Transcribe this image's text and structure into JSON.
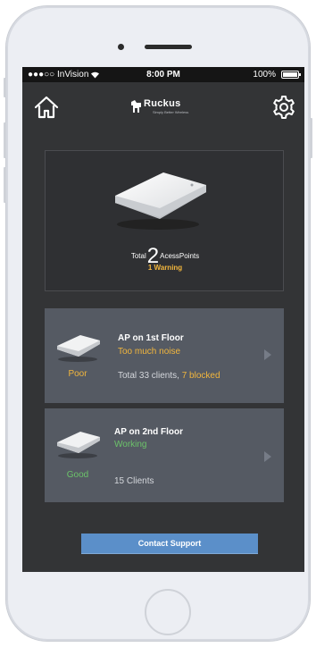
{
  "status_bar": {
    "carrier": "●●●○○ InVision",
    "wifi_icon": "wifi-icon",
    "time": "8:00 PM",
    "battery": "100%"
  },
  "header": {
    "brand": "Ruckus",
    "brand_tagline": "Simply Better Wireless",
    "home_icon": "home-icon",
    "settings_icon": "gear-icon"
  },
  "summary": {
    "total_prefix": "Total",
    "total_count": "2",
    "total_suffix": "AcessPoints",
    "warning": "1 Warning"
  },
  "access_points": [
    {
      "title": "AP on 1st Floor",
      "status_text": "Too much noise",
      "health": "Poor",
      "details_prefix": "Total 33 clients, ",
      "details_highlight": "7 blocked"
    },
    {
      "title": "AP on 2nd Floor",
      "status_text": "Working",
      "health": "Good",
      "details_prefix": "15 Clients",
      "details_highlight": ""
    }
  ],
  "footer": {
    "contact_label": "Contact Support"
  },
  "colors": {
    "screen_bg": "#333436",
    "card_bg": "#555a63",
    "warning": "#f2b63d",
    "good": "#6cc36a",
    "button": "#5b8fc9"
  }
}
